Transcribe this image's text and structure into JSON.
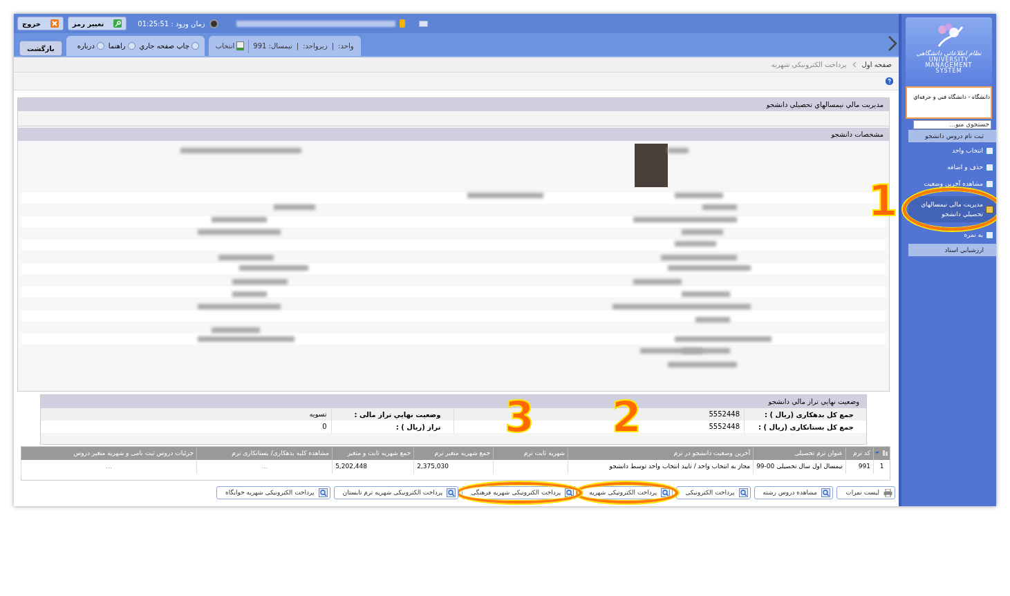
{
  "top_bar": {
    "logout": "خروج",
    "change_password": "تغيير رمز",
    "login_time_label": "زمان ورود :",
    "login_time": "01:25:51"
  },
  "toolbar": {
    "separator": "|",
    "unit_label": "واحد:",
    "subunit_label": "زيرواحد:",
    "semester_label": "نيمسال:",
    "semester": "991",
    "select": "انتخاب",
    "print": "چاپ صفحه جاري",
    "help": "راهنما",
    "about": "درباره",
    "back_tooltip": "بازگشت"
  },
  "breadcrumb": [
    "صفحه اول",
    "پرداخت الکترونيکي شهريه"
  ],
  "panel_title": "مديريت مالي نيمسالهاي تحصيلي دانشجو",
  "student_section_title": "مشخصات دانشجو",
  "balance": {
    "title": "وضعيت نهايي تراز مالي دانشجو",
    "rows": [
      [
        {
          "label": "جمع کل بدهکاری (ريال ) :",
          "value": "5552448"
        },
        {
          "label": "وضعيت نهايي تراز مالی :",
          "value": "تسويه"
        }
      ],
      [
        {
          "label": "جمع کل بستانکاری (ريال ) :",
          "value": "5552448"
        },
        {
          "label": "تراز (ريال ) :",
          "value": "0"
        }
      ]
    ]
  },
  "table": {
    "columns": [
      "کد ترم",
      "عنوان ترم تحصيلی",
      "آخرين وضعيت دانشجو در ترم",
      "شهريه ثابت ترم",
      "جمع شهريه متغير ترم",
      "جمع شهريه ثابت و متغير",
      "مشاهده کليه بدهکاری/ بستانکاری ترم",
      "جزئيات دروس ثبت نامی و شهريه متغير دروس"
    ],
    "rows": [
      {
        "number": "1",
        "cells": [
          "991",
          "نيمسال اول سال تحصيلی 00-99",
          "مجاز به انتخاب واحد / تاييد انتخاب واحد توسط دانشجو",
          null,
          "2,375,030",
          "5,202,448",
          "...",
          "..."
        ]
      }
    ]
  },
  "buttons": [
    {
      "kind": "print",
      "label": "ليست نمرات"
    },
    {
      "kind": "view",
      "label": "مشاهده دروس رشته"
    },
    {
      "kind": "view",
      "label": "پرداخت الکترونيکی"
    },
    {
      "kind": "pay",
      "label": "پرداخت الکترونيکی شهريه",
      "annotation": "2"
    },
    {
      "kind": "pay",
      "label": "پرداخت الکترونيکی شهريه فرهنگی",
      "annotation": "3"
    },
    {
      "kind": "view",
      "label": "پرداخت الکترونيکی شهريه ترم تابستان"
    },
    {
      "kind": "view",
      "label": "پرداخت الکترونيکی شهريه خوابگاه"
    }
  ],
  "sidebar": {
    "logo_script": "نظام اطلاعاتی دانشگاهی",
    "logo_lines": [
      "UNIVERSITY",
      "MANAGEMENT",
      "SYSTEM"
    ],
    "university": "دانشگاه - دانشگاه فني و حرفه‌اي",
    "search_placeholder": "جستجوي منو...",
    "menu": [
      {
        "kind": "header",
        "label": "ثبت نام دروس دانشجو"
      },
      {
        "kind": "item",
        "label": "انتخاب واحد",
        "selected": false
      },
      {
        "kind": "item",
        "label": "حذف و اضافه",
        "selected": false
      },
      {
        "kind": "item",
        "label": "مشاهده آخرين وضعيت",
        "selected": false
      },
      {
        "kind": "item",
        "label": "مديريت مالی نيمسالهاي تحصيلي دانشجو",
        "selected": true,
        "annotation": "1"
      },
      {
        "kind": "item",
        "label": "به نمره",
        "selected": false
      },
      {
        "kind": "header",
        "label": "ارزشيابي استاد"
      }
    ]
  }
}
